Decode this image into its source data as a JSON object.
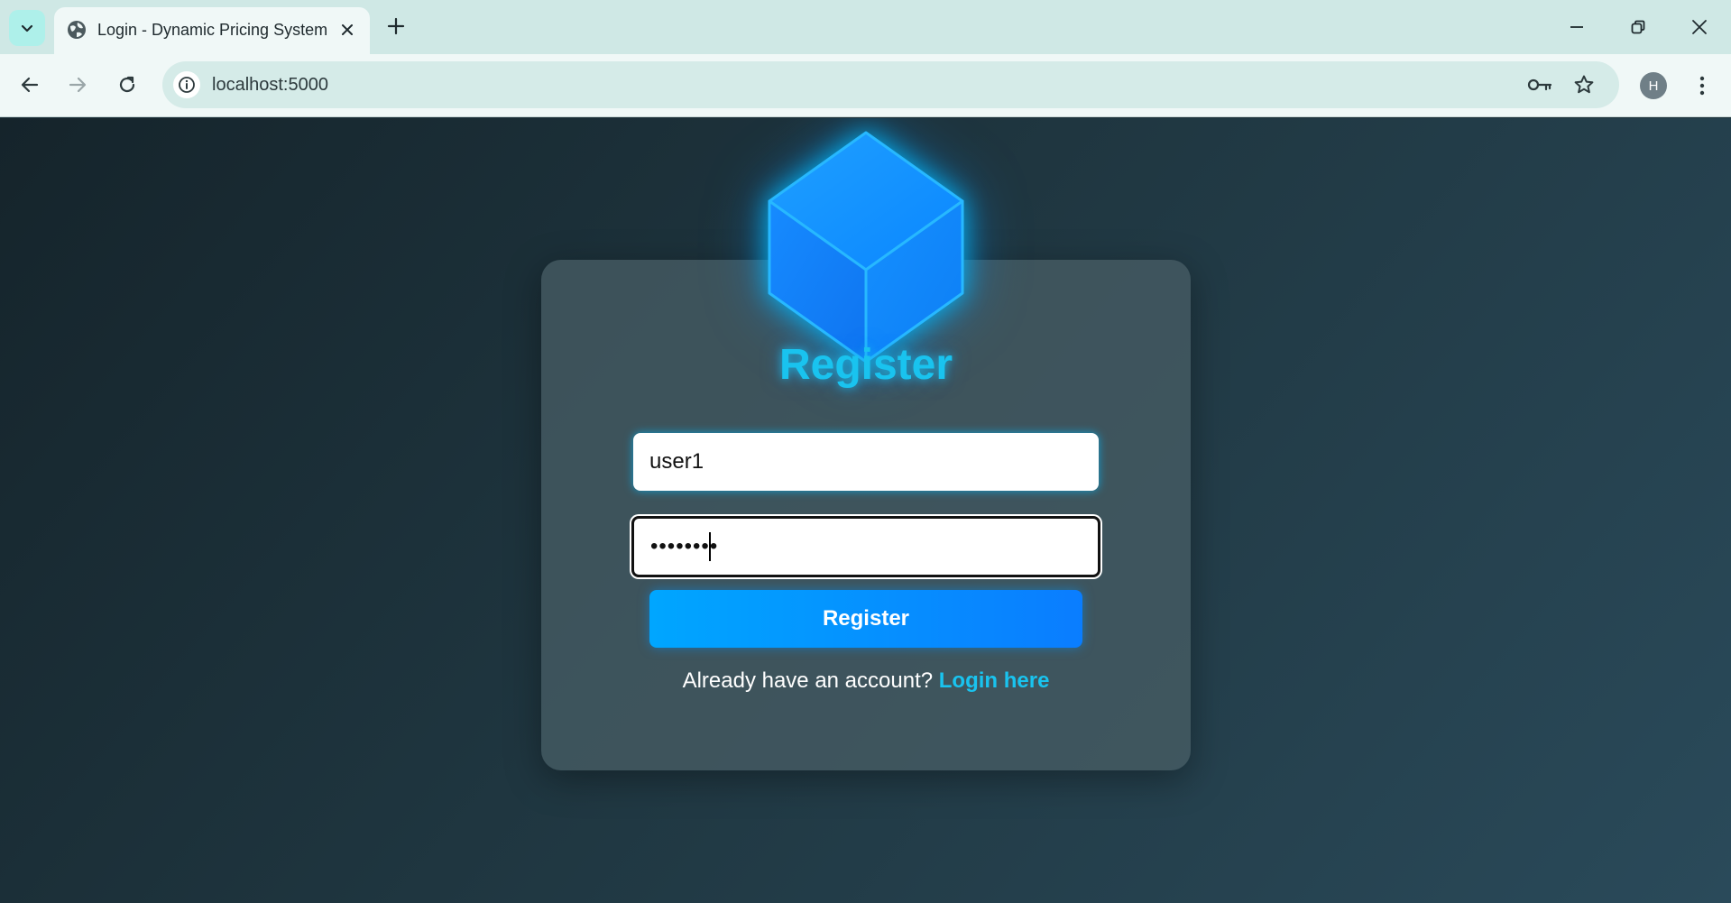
{
  "browser": {
    "tab": {
      "title": "Login - Dynamic Pricing System"
    },
    "address_bar": {
      "url": "localhost:5000"
    },
    "profile": {
      "initial": "H"
    }
  },
  "page": {
    "heading": "Register",
    "username": {
      "value": "user1"
    },
    "password": {
      "value": "••••••••"
    },
    "submit_label": "Register",
    "footer": {
      "prompt": "Already have an account?",
      "link_label": "Login here"
    }
  },
  "colors": {
    "accent": "#19c3ef",
    "button": "#0a8dff",
    "card": "#465c64"
  },
  "icons": {
    "tab_search": "chevron-down-icon",
    "favicon": "globe-icon",
    "close_tab": "close-icon",
    "new_tab": "plus-icon",
    "back": "arrow-left-icon",
    "forward": "arrow-right-icon",
    "reload": "reload-icon",
    "site_info": "info-icon",
    "password_manager": "key-icon",
    "bookmark": "star-icon",
    "menu": "kebab-menu-icon",
    "logo": "cube-icon"
  }
}
